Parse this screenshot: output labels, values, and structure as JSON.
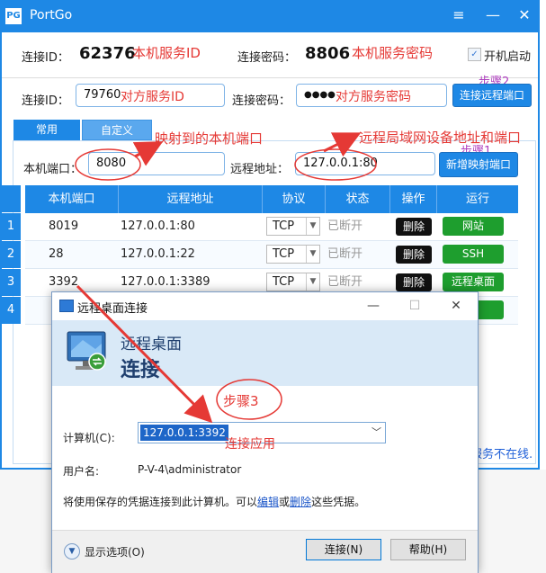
{
  "app": {
    "title": "PortGo",
    "logo": "PG",
    "window_controls": [
      "≡",
      "—",
      "✕"
    ]
  },
  "row1": {
    "conn_id_label": "连接ID：",
    "conn_id_value": "62376",
    "conn_id_note": "本机服务ID",
    "password_label": "连接密码：",
    "password_value": "8806",
    "password_note": "本机服务密码",
    "autostart_label": "开机启动",
    "autostart_checked": true
  },
  "row2": {
    "conn_id_label": "连接ID：",
    "conn_id_value": "79760",
    "conn_id_note": "对方服务ID",
    "password_label": "连接密码：",
    "password_value": "●●●●",
    "password_note": "对方服务密码",
    "connect_button": "连接远程端口",
    "step_label": "步骤2"
  },
  "tabs": [
    {
      "label": "常用",
      "active": true
    },
    {
      "label": "自定义",
      "active": false
    }
  ],
  "row3": {
    "local_port_label": "本机端口：",
    "local_port_value": "8080",
    "remote_addr_label": "远程地址：",
    "remote_addr_value": "127.0.0.1:80",
    "add_button": "新增映射端口",
    "step_label": "步骤1",
    "note_local": "映射到的本机端口",
    "note_remote": "远程局域网设备地址和端口"
  },
  "table": {
    "headers": [
      "本机端口",
      "远程地址",
      "协议",
      "状态",
      "操作",
      "运行"
    ],
    "rows": [
      {
        "index": "1",
        "port": "8019",
        "remote": "127.0.0.1:80",
        "protocol": "TCP",
        "status": "已断开",
        "action": "删除",
        "run": "网站"
      },
      {
        "index": "2",
        "port": "28",
        "remote": "127.0.0.1:22",
        "protocol": "TCP",
        "status": "已断开",
        "action": "删除",
        "run": "SSH"
      },
      {
        "index": "3",
        "port": "3392",
        "remote": "127.0.0.1:3389",
        "protocol": "TCP",
        "status": "已断开",
        "action": "删除",
        "run": "远程桌面"
      },
      {
        "index": "4",
        "run": "置"
      }
    ]
  },
  "status_text": "服务不在线.",
  "rdp": {
    "title": "远程桌面连接",
    "banner_line1": "远程桌面",
    "banner_line2": "连接",
    "step_label": "步骤3",
    "computer_label": "计算机(C):",
    "computer_value": "127.0.0.1:3392",
    "computer_note": "连接应用",
    "user_label": "用户名:",
    "user_value": "P-V-4\\administrator",
    "cred_text_1": "将使用保存的凭据连接到此计算机。可以",
    "cred_link_edit": "编辑",
    "cred_text_2": "或",
    "cred_link_delete": "删除",
    "cred_text_3": "这些凭据。",
    "show_options": "显示选项(O)",
    "connect_button": "连接(N)",
    "help_button": "帮助(H)",
    "controls": [
      "—",
      "☐",
      "✕"
    ]
  },
  "colors": {
    "brand_blue": "#1e88e5",
    "annotation_red": "#e53935",
    "run_green": "#1e9e2e"
  }
}
